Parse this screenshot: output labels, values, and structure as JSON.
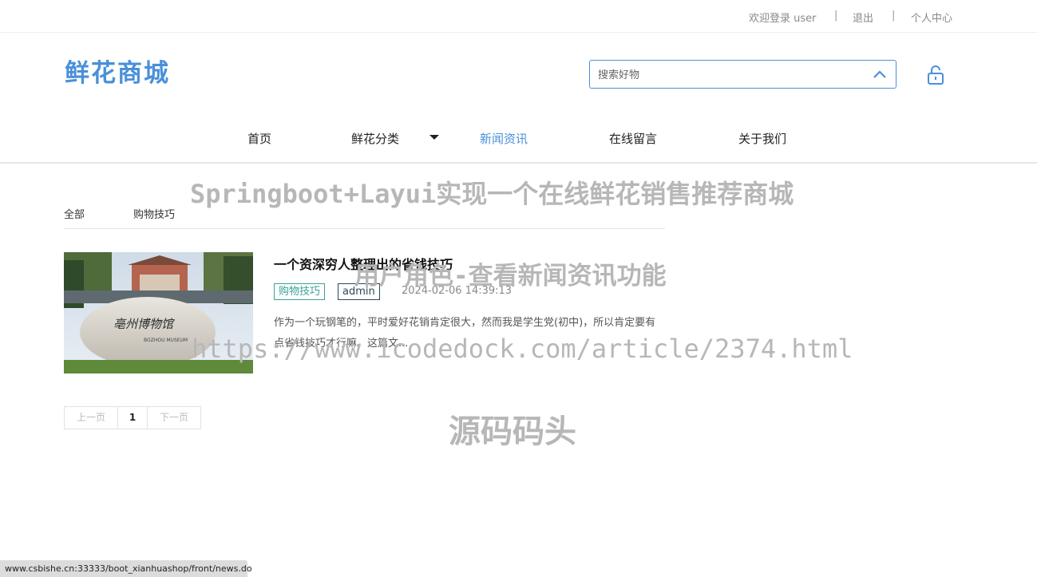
{
  "topbar": {
    "welcome": "欢迎登录 user",
    "separator1": "|",
    "logout": "退出",
    "separator2": "|",
    "profile": "个人中心"
  },
  "logo": "鲜花商城",
  "search": {
    "placeholder": "搜索好物"
  },
  "nav": {
    "items": [
      "首页",
      "鲜花分类",
      "新闻资讯",
      "在线留言",
      "关于我们"
    ],
    "active": "新闻资讯"
  },
  "watermarks": {
    "line1": "Springboot+Layui实现一个在线鲜花销售推荐商城",
    "line2": "用户角色-查看新闻资讯功能",
    "line3": "https://www.icodedock.com/article/2374.html",
    "line4": "源码码头"
  },
  "categories": [
    "全部",
    "购物技巧"
  ],
  "article": {
    "title": "一个资深穷人整理出的省钱技巧",
    "tag": "购物技巧",
    "author": "admin",
    "date": "2024-02-06 14:39:13",
    "summary": "作为一个玩钢笔的，平时爱好花销肯定很大，然而我是学生党(初中)，所以肯定要有点省钱技巧才行嘛。这篇文...",
    "image_text": "亳州博物馆",
    "image_subtext": "BOZHOU MUSEUM"
  },
  "pagination": {
    "prev": "上一页",
    "current": "1",
    "next": "下一页"
  },
  "status_url": "www.csbishe.cn:33333/boot_xianhuashop/front/news.do",
  "colors": {
    "accent": "#4a90d9",
    "tag_green": "#3aa29a",
    "watermark": "#b7b7b7"
  }
}
